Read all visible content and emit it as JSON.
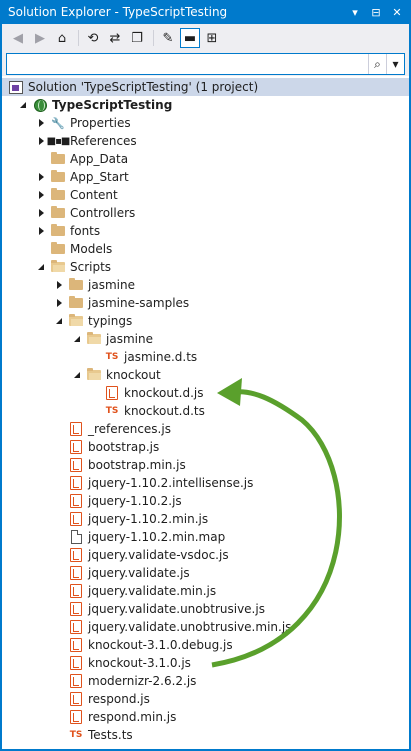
{
  "window": {
    "title": "Solution Explorer - TypeScriptTesting",
    "controls": [
      "▾",
      "⊟",
      "✕"
    ]
  },
  "toolbar": {
    "buttons": [
      {
        "name": "back-button",
        "glyph": "◀",
        "disabled": true
      },
      {
        "name": "forward-button",
        "glyph": "▶",
        "disabled": true
      },
      {
        "name": "home-button",
        "glyph": "⌂"
      },
      {
        "name": "sync-button",
        "glyph": "⟲"
      },
      {
        "name": "pending-changes-button",
        "glyph": "⇄"
      },
      {
        "name": "collapse-all-button",
        "glyph": "❐"
      },
      {
        "name": "properties-button",
        "glyph": "✎"
      },
      {
        "name": "show-all-files-button",
        "glyph": "▬",
        "active": true
      },
      {
        "name": "class-diagram-button",
        "glyph": "⊞"
      }
    ]
  },
  "search": {
    "value": "",
    "placeholder": ""
  },
  "tree": [
    {
      "kind": "solution",
      "label": "Solution 'TypeScriptTesting' (1 project)",
      "depth": 0,
      "arrow": "none"
    },
    {
      "kind": "project",
      "label": "TypeScriptTesting",
      "depth": 1,
      "arrow": "down",
      "bold": true
    },
    {
      "kind": "properties",
      "label": "Properties",
      "depth": 2,
      "arrow": "right"
    },
    {
      "kind": "references",
      "label": "References",
      "depth": 2,
      "arrow": "right"
    },
    {
      "kind": "folder",
      "label": "App_Data",
      "depth": 2,
      "arrow": "none"
    },
    {
      "kind": "folder",
      "label": "App_Start",
      "depth": 2,
      "arrow": "right"
    },
    {
      "kind": "folder",
      "label": "Content",
      "depth": 2,
      "arrow": "right"
    },
    {
      "kind": "folder",
      "label": "Controllers",
      "depth": 2,
      "arrow": "right"
    },
    {
      "kind": "folder",
      "label": "fonts",
      "depth": 2,
      "arrow": "right"
    },
    {
      "kind": "folder",
      "label": "Models",
      "depth": 2,
      "arrow": "none"
    },
    {
      "kind": "folder-open",
      "label": "Scripts",
      "depth": 2,
      "arrow": "down"
    },
    {
      "kind": "folder",
      "label": "jasmine",
      "depth": 3,
      "arrow": "right"
    },
    {
      "kind": "folder",
      "label": "jasmine-samples",
      "depth": 3,
      "arrow": "right"
    },
    {
      "kind": "folder-open",
      "label": "typings",
      "depth": 3,
      "arrow": "down"
    },
    {
      "kind": "folder-open",
      "label": "jasmine",
      "depth": 4,
      "arrow": "down"
    },
    {
      "kind": "ts",
      "label": "jasmine.d.ts",
      "depth": 5,
      "arrow": "none"
    },
    {
      "kind": "folder-open",
      "label": "knockout",
      "depth": 4,
      "arrow": "down"
    },
    {
      "kind": "js",
      "label": "knockout.d.js",
      "depth": 5,
      "arrow": "none"
    },
    {
      "kind": "ts",
      "label": "knockout.d.ts",
      "depth": 5,
      "arrow": "none"
    },
    {
      "kind": "js",
      "label": "_references.js",
      "depth": 3,
      "arrow": "none"
    },
    {
      "kind": "js",
      "label": "bootstrap.js",
      "depth": 3,
      "arrow": "none"
    },
    {
      "kind": "js",
      "label": "bootstrap.min.js",
      "depth": 3,
      "arrow": "none"
    },
    {
      "kind": "js",
      "label": "jquery-1.10.2.intellisense.js",
      "depth": 3,
      "arrow": "none"
    },
    {
      "kind": "js",
      "label": "jquery-1.10.2.js",
      "depth": 3,
      "arrow": "none"
    },
    {
      "kind": "js",
      "label": "jquery-1.10.2.min.js",
      "depth": 3,
      "arrow": "none"
    },
    {
      "kind": "file",
      "label": "jquery-1.10.2.min.map",
      "depth": 3,
      "arrow": "none"
    },
    {
      "kind": "js",
      "label": "jquery.validate-vsdoc.js",
      "depth": 3,
      "arrow": "none"
    },
    {
      "kind": "js",
      "label": "jquery.validate.js",
      "depth": 3,
      "arrow": "none"
    },
    {
      "kind": "js",
      "label": "jquery.validate.min.js",
      "depth": 3,
      "arrow": "none"
    },
    {
      "kind": "js",
      "label": "jquery.validate.unobtrusive.js",
      "depth": 3,
      "arrow": "none"
    },
    {
      "kind": "js",
      "label": "jquery.validate.unobtrusive.min.js",
      "depth": 3,
      "arrow": "none"
    },
    {
      "kind": "js",
      "label": "knockout-3.1.0.debug.js",
      "depth": 3,
      "arrow": "none"
    },
    {
      "kind": "js",
      "label": "knockout-3.1.0.js",
      "depth": 3,
      "arrow": "none"
    },
    {
      "kind": "js",
      "label": "modernizr-2.6.2.js",
      "depth": 3,
      "arrow": "none"
    },
    {
      "kind": "js",
      "label": "respond.js",
      "depth": 3,
      "arrow": "none"
    },
    {
      "kind": "js",
      "label": "respond.min.js",
      "depth": 3,
      "arrow": "none"
    },
    {
      "kind": "ts",
      "label": "Tests.ts",
      "depth": 3,
      "arrow": "none"
    }
  ],
  "annotation": {
    "color": "#5aa02c"
  },
  "colors": {
    "accent": "#007acc",
    "toolbar_bg": "#eeeef2",
    "js_icon": "#e0521c",
    "folder": "#dcb67a"
  }
}
